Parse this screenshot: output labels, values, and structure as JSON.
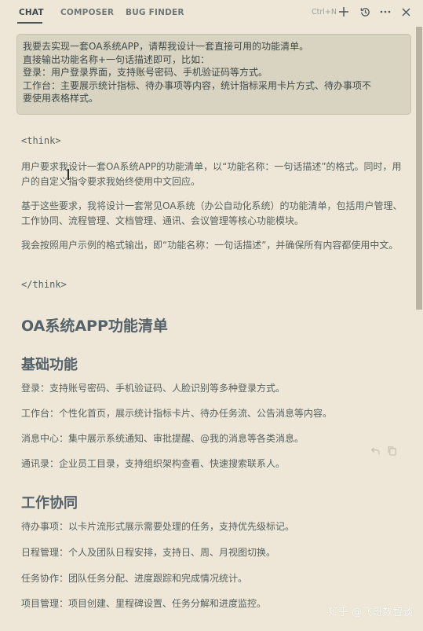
{
  "tabs": [
    {
      "label": "CHAT",
      "active": true
    },
    {
      "label": "COMPOSER",
      "active": false
    },
    {
      "label": "BUG FINDER",
      "active": false
    }
  ],
  "toolbar": {
    "shortcut": "Ctrl+N",
    "icons": [
      "plus-icon",
      "history-icon",
      "more-icon",
      "close-icon"
    ]
  },
  "prompt": {
    "lines": [
      "我要去实现一套OA系统APP，请帮我设计一套直接可用的功能清单。",
      "直接输出功能名称+一句话描述即可，比如：",
      "登录：用户登录界面，支持账号密码、手机验证码等方式。",
      "工作台：主要展示统计指标、待办事项等内容，统计指标采用卡片方式、待办事项不",
      "要使用表格样式。"
    ]
  },
  "response": {
    "think_open": "<think>",
    "think_paragraphs": [
      "用户要求我设计一套OA系统APP的功能清单，以“功能名称：一句话描述”的格式。同时，用户的自定义指令要求我始终使用中文回应。",
      "基于这些要求，我将设计一套常见OA系统（办公自动化系统）的功能清单，包括用户管理、工作协同、流程管理、文档管理、通讯、会议管理等核心功能模块。",
      "我会按照用户示例的格式输出，即“功能名称：一句话描述”，并确保所有内容都使用中文。"
    ],
    "think_close": "</think>",
    "title": "OA系统APP功能清单",
    "sections": [
      {
        "heading": "基础功能",
        "items": [
          "登录：支持账号密码、手机验证码、人脸识别等多种登录方式。",
          "工作台：个性化首页，展示统计指标卡片、待办任务流、公告消息等内容。",
          "消息中心：集中展示系统通知、审批提醒、@我的消息等各类消息。",
          "通讯录：企业员工目录，支持组织架构查看、快速搜索联系人。"
        ]
      },
      {
        "heading": "工作协同",
        "items": [
          "待办事项：以卡片流形式展示需要处理的任务，支持优先级标记。",
          "日程管理：个人及团队日程安排，支持日、周、月视图切换。",
          "任务协作：团队任务分配、进度跟踪和完成情况统计。",
          "项目管理：项目创建、里程碑设置、任务分解和进度监控。"
        ]
      }
    ]
  },
  "message_actions": [
    "undo-icon",
    "copy-icon"
  ],
  "watermark": "知乎 @飞哥数智谈"
}
